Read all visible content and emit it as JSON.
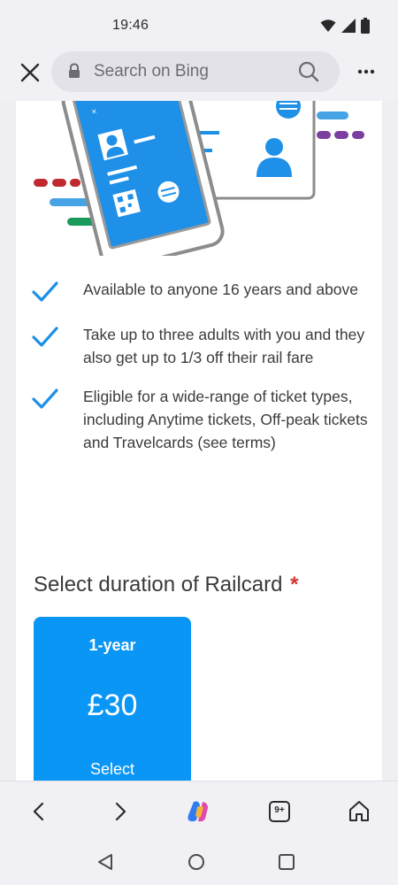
{
  "status_bar": {
    "time": "19:46"
  },
  "browser": {
    "search_placeholder": "Search on Bing",
    "tab_count": "9+"
  },
  "features": [
    "Available to anyone 16 years and above",
    "Take up to three adults with you and they also get up to 1/3 off their rail fare",
    "Eligible for a wide-range of ticket types, including Anytime tickets, Off-peak tickets and Travelcards (see terms)"
  ],
  "duration": {
    "title": "Select duration of Railcard",
    "required_mark": "*"
  },
  "plan": {
    "period": "1-year",
    "price": "£30",
    "select_label": "Select"
  },
  "colors": {
    "accent": "#0a96f5",
    "required": "#d8322f"
  }
}
